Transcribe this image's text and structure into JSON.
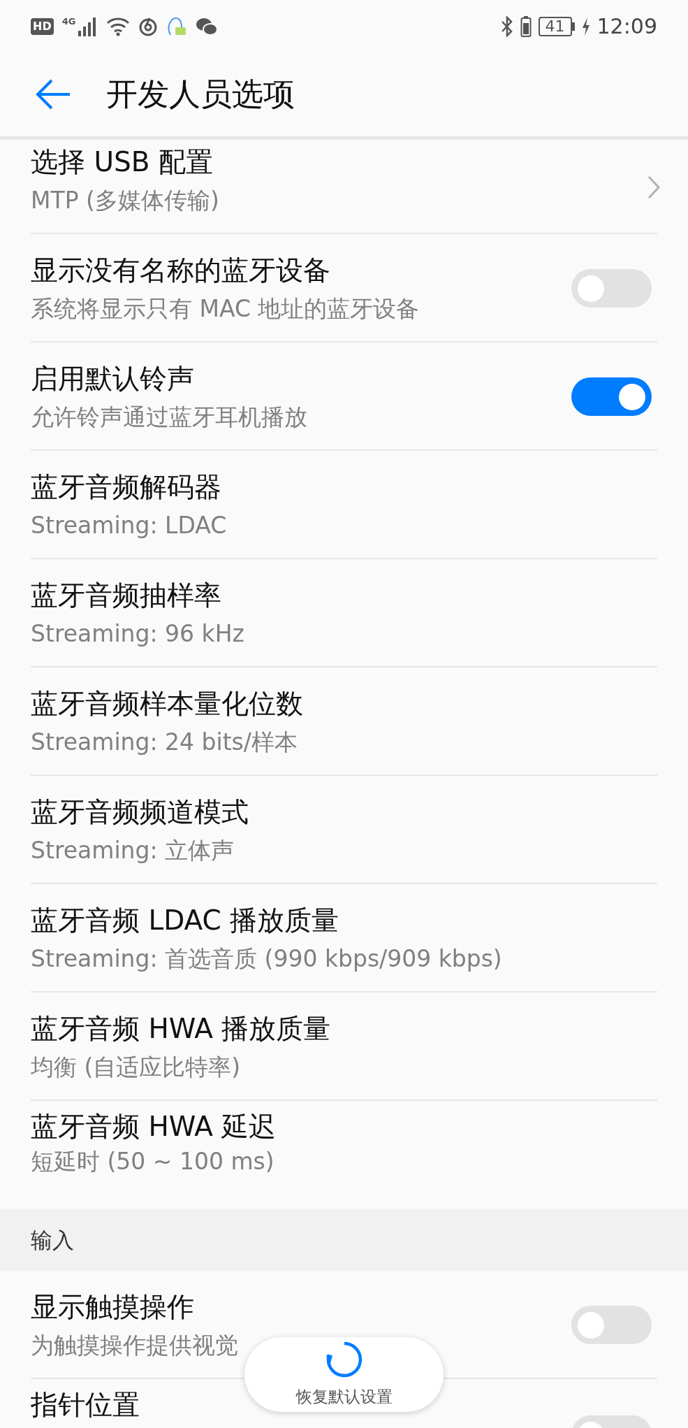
{
  "status_bar": {
    "hd": "HD",
    "network": "4G",
    "battery": "41",
    "time": "12:09"
  },
  "header": {
    "title": "开发人员选项"
  },
  "settings": [
    {
      "kind": "link",
      "title": "选择 USB 配置",
      "subtitle": "MTP (多媒体传输)"
    },
    {
      "kind": "toggle",
      "title": "显示没有名称的蓝牙设备",
      "subtitle": "系统将显示只有 MAC 地址的蓝牙设备",
      "on": false
    },
    {
      "kind": "toggle",
      "title": "启用默认铃声",
      "subtitle": "允许铃声通过蓝牙耳机播放",
      "on": true
    },
    {
      "kind": "plain",
      "title": "蓝牙音频解码器",
      "subtitle": "Streaming: LDAC"
    },
    {
      "kind": "plain",
      "title": "蓝牙音频抽样率",
      "subtitle": "Streaming: 96 kHz"
    },
    {
      "kind": "plain",
      "title": "蓝牙音频样本量化位数",
      "subtitle": "Streaming: 24 bits/样本"
    },
    {
      "kind": "plain",
      "title": "蓝牙音频频道模式",
      "subtitle": "Streaming: 立体声"
    },
    {
      "kind": "plain",
      "title": "蓝牙音频 LDAC 播放质量",
      "subtitle": "Streaming: 首选音质 (990 kbps/909 kbps)"
    },
    {
      "kind": "plain",
      "title": "蓝牙音频 HWA 播放质量",
      "subtitle": "均衡 (自适应比特率)"
    },
    {
      "kind": "plain",
      "title": "蓝牙音频 HWA 延迟",
      "subtitle": "短延时 (50 ~ 100 ms)"
    }
  ],
  "section": {
    "title": "输入"
  },
  "input_settings": [
    {
      "kind": "toggle",
      "title": "显示触摸操作",
      "subtitle": "为触摸操作提供视觉",
      "on": false
    },
    {
      "kind": "toggle",
      "title": "指针位置",
      "on": false
    }
  ],
  "floating_button": {
    "label": "恢复默认设置"
  }
}
